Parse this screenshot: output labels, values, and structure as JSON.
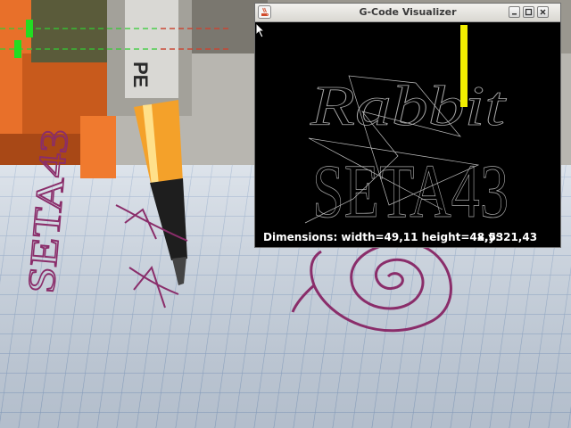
{
  "window": {
    "title": "G-Code Visualizer",
    "dimensions_text": "Dimensions: width=49,11 height=48,53",
    "coordinates_text": "x,y: 21,43"
  },
  "drawing": {
    "line1": "Rabbit",
    "line2": "SETA43"
  },
  "paper_drawing": {
    "text": "SETA43",
    "pen_label": "PE"
  },
  "colors": {
    "background": "#000000",
    "toolpath": "#a8a8a8",
    "tool_marker": "#f2ee00",
    "ink": "#8a2d6a",
    "titlebar": "#e4e2dd"
  },
  "icons": {
    "app": "java-cup-icon",
    "minimize": "minimize-icon",
    "maximize": "maximize-icon",
    "close": "close-icon",
    "cursor": "mouse-pointer-icon"
  }
}
